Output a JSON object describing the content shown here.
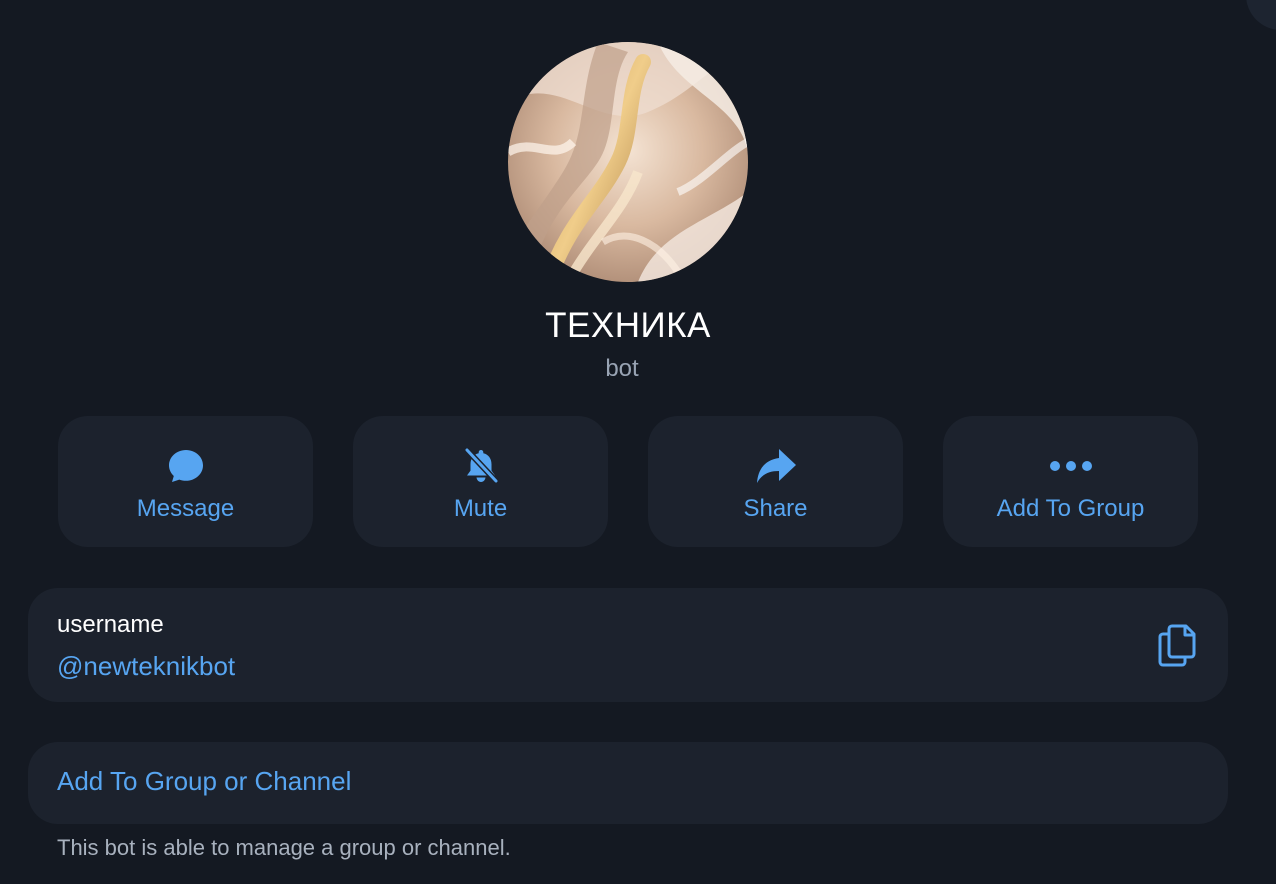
{
  "profile": {
    "name": "ТЕХНИКА",
    "subtitle": "bot"
  },
  "actions": [
    {
      "label": "Message",
      "icon": "message-bubble-icon"
    },
    {
      "label": "Mute",
      "icon": "bell-slash-icon"
    },
    {
      "label": "Share",
      "icon": "share-arrow-icon"
    },
    {
      "label": "Add To Group",
      "icon": "more-dots-icon"
    }
  ],
  "username": {
    "label": "username",
    "value": "@newteknikbot",
    "copy_icon": "copy-icon"
  },
  "add_to_group": {
    "label": "Add To Group or Channel",
    "note": "This bot is able to manage a group or channel."
  },
  "colors": {
    "background": "#141922",
    "card": "#1c222d",
    "accent": "#57a5f1",
    "muted_text": "#98a3b3"
  }
}
